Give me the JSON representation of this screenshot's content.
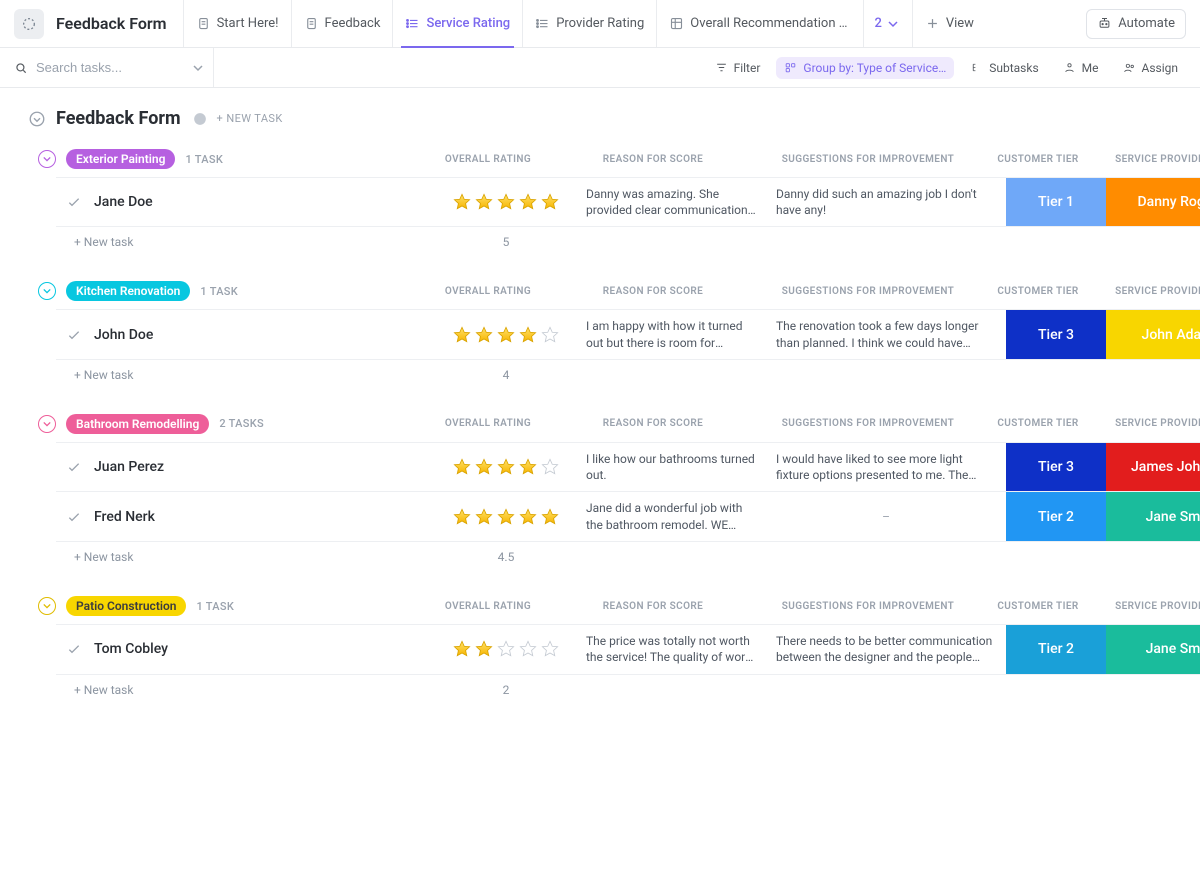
{
  "header": {
    "title": "Feedback Form",
    "tabs": [
      {
        "label": "Start Here!"
      },
      {
        "label": "Feedback"
      },
      {
        "label": "Service Rating",
        "active": true
      },
      {
        "label": "Provider Rating"
      },
      {
        "label": "Overall Recommendation …"
      }
    ],
    "more_count": "2",
    "view_label": "View",
    "automate_label": "Automate"
  },
  "toolbar": {
    "search_placeholder": "Search tasks...",
    "filter": "Filter",
    "groupby": "Group by: Type of Service…",
    "subtasks": "Subtasks",
    "me": "Me",
    "assign": "Assign"
  },
  "board": {
    "title": "Feedback Form",
    "new_task_top": "+ NEW TASK",
    "columns": {
      "rating": "OVERALL RATING",
      "reason": "REASON FOR SCORE",
      "suggest": "SUGGESTIONS FOR IMPROVEMENT",
      "tier": "CUSTOMER TIER",
      "provider": "SERVICE PROVIDER"
    },
    "new_task_label": "+ New task"
  },
  "groups": [
    {
      "name": "Exterior Painting",
      "pill_class": "c-purple",
      "ring_class": "tx-purple",
      "count_label": "1 TASK",
      "avg": "5",
      "rows": [
        {
          "name": "Jane Doe",
          "rating": 5,
          "reason": "Danny was amazing. She provided clear communication of time…",
          "suggest": "Danny did such an amazing job I don't have any!",
          "tier": "Tier 1",
          "tier_class": "tier-1",
          "provider": "Danny Rogers",
          "provider_class": "prov-orange"
        }
      ]
    },
    {
      "name": "Kitchen Renovation",
      "pill_class": "c-teal",
      "ring_class": "tx-teal",
      "count_label": "1 TASK",
      "avg": "4",
      "rows": [
        {
          "name": "John Doe",
          "rating": 4,
          "reason": "I am happy with how it turned out but there is room for improvement",
          "suggest": "The renovation took a few days longer than planned. I think we could have finished on …",
          "tier": "Tier 3",
          "tier_class": "tier-3",
          "provider": "John Adams",
          "provider_class": "prov-yellow"
        }
      ]
    },
    {
      "name": "Bathroom Remodelling",
      "pill_class": "c-pink",
      "ring_class": "tx-pink",
      "count_label": "2 TASKS",
      "avg": "4.5",
      "rows": [
        {
          "name": "Juan Perez",
          "rating": 4,
          "reason": "I like how our bathrooms turned out.",
          "suggest": "I would have liked to see more light fixture options presented to me. The options provided…",
          "tier": "Tier 3",
          "tier_class": "tier-3",
          "provider": "James Johnson",
          "provider_class": "prov-red"
        },
        {
          "name": "Fred Nerk",
          "rating": 5,
          "reason": "Jane did a wonderful job with the bathroom remodel. WE LOVE IT!",
          "suggest": "–",
          "suggest_dash": true,
          "tier": "Tier 2",
          "tier_class": "tier-2",
          "provider": "Jane Smith",
          "provider_class": "prov-green"
        }
      ]
    },
    {
      "name": "Patio Construction",
      "pill_class": "c-yellow",
      "ring_class": "tx-yellow",
      "count_label": "1 TASK",
      "avg": "2",
      "rows": [
        {
          "name": "Tom Cobley",
          "rating": 2,
          "reason": "The price was totally not worth the service! The quality of work …",
          "suggest": "There needs to be better communication between the designer and the people doing the…",
          "tier": "Tier 2",
          "tier_class": "tier-2b",
          "provider": "Jane Smith",
          "provider_class": "prov-green"
        }
      ]
    }
  ]
}
